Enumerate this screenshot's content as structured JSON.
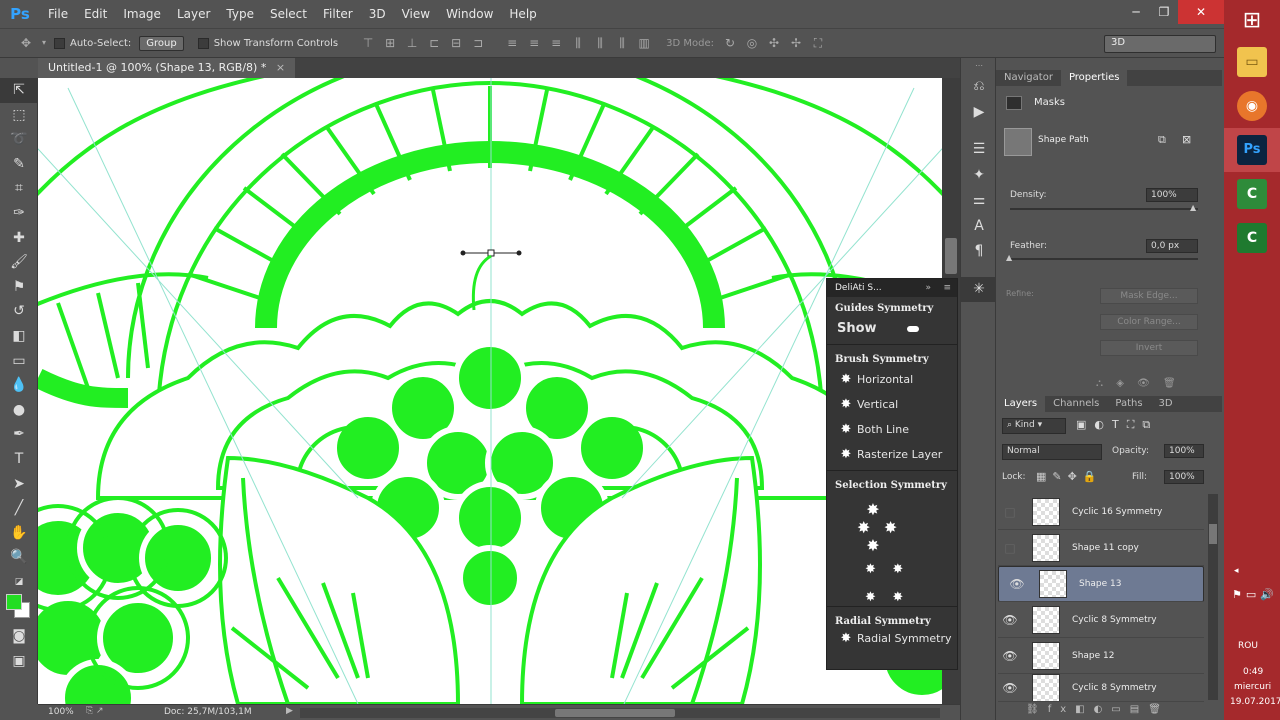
{
  "app": {
    "logo": "Ps",
    "document_tab": "Untitled-1 @ 100% (Shape 13, RGB/8) *",
    "tab_close": "×"
  },
  "menu": [
    "File",
    "Edit",
    "Image",
    "Layer",
    "Type",
    "Select",
    "Filter",
    "3D",
    "View",
    "Window",
    "Help"
  ],
  "window_controls": {
    "minimize": "─",
    "restore": "❐",
    "close": "✕"
  },
  "options": {
    "auto_select_label": "Auto-Select:",
    "auto_select_value": "Group",
    "show_transform_label": "Show Transform Controls",
    "mode_label": "3D Mode:",
    "workspace": "3D"
  },
  "tools": [
    "move",
    "marquee",
    "lasso",
    "quick-select",
    "crop",
    "eyedropper",
    "healing",
    "brush",
    "stamp",
    "history-brush",
    "eraser",
    "gradient",
    "blur",
    "dodge",
    "pen",
    "type",
    "path-select",
    "line",
    "hand",
    "zoom"
  ],
  "colors": {
    "foreground": "#22dd22",
    "background": "#ffffff",
    "mandala": "#22ee22",
    "guide": "#93e3cf",
    "selected_layer": "#6e7a93"
  },
  "status": {
    "zoom": "100%",
    "doc": "Doc: 25,7M/103,1M"
  },
  "symmetry_panel": {
    "title": "DeliAti S...",
    "guides": {
      "heading": "Guides Symmetry",
      "show": "Show"
    },
    "brush": {
      "heading": "Brush Symmetry",
      "items": [
        "Horizontal",
        "Vertical",
        "Both Line",
        "Rasterize Layer"
      ]
    },
    "selection": {
      "heading": "Selection Symmetry"
    },
    "radial": {
      "heading": "Radial Symmetry",
      "item": "Radial Symmetry"
    }
  },
  "properties": {
    "tabs": [
      "Navigator",
      "Properties"
    ],
    "masks_label": "Masks",
    "shape_path": "Shape Path",
    "density_label": "Density:",
    "density_value": "100%",
    "feather_label": "Feather:",
    "feather_value": "0,0 px",
    "refine_label": "Refine:",
    "mask_edge": "Mask Edge...",
    "color_range": "Color Range...",
    "invert": "Invert"
  },
  "layers_panel": {
    "tabs": [
      "Layers",
      "Channels",
      "Paths",
      "3D"
    ],
    "kind": "Kind",
    "blend_mode": "Normal",
    "opacity_label": "Opacity:",
    "opacity_value": "100%",
    "lock_label": "Lock:",
    "fill_label": "Fill:",
    "fill_value": "100%",
    "layers": [
      {
        "name": "Cyclic 16 Symmetry",
        "visible": false,
        "selected": false
      },
      {
        "name": "Shape 11 copy",
        "visible": false,
        "selected": false
      },
      {
        "name": "Shape 13",
        "visible": true,
        "selected": true
      },
      {
        "name": "Cyclic 8 Symmetry",
        "visible": true,
        "selected": false
      },
      {
        "name": "Shape 12",
        "visible": true,
        "selected": false
      },
      {
        "name": "Cyclic 8 Symmetry",
        "visible": true,
        "selected": false
      }
    ]
  },
  "taskbar": {
    "lang": "ROU",
    "time": "0:49",
    "day": "miercuri",
    "date": "19.07.2017"
  }
}
